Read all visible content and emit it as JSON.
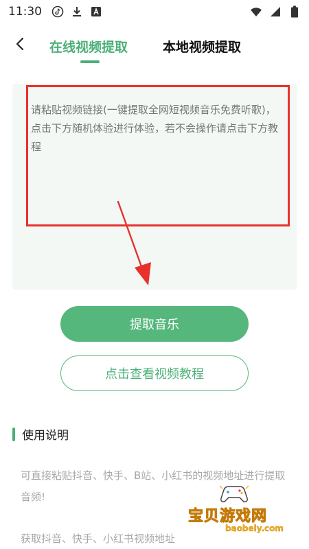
{
  "status_bar": {
    "time": "11:30",
    "left_icons": [
      "tiktok-icon",
      "download-icon",
      "a-badge-icon"
    ],
    "right_icons": [
      "wifi-icon",
      "signal-icon",
      "battery-icon"
    ]
  },
  "header": {
    "back_icon": "chevron-left-icon",
    "tabs": [
      {
        "label": "在线视频提取",
        "active": true
      },
      {
        "label": "本地视频提取",
        "active": false
      }
    ]
  },
  "input": {
    "placeholder": "请粘贴视频链接(一键提取全网短视频音乐免费听歌)，点击下方随机体验进行体验，若不会操作请点击下方教程",
    "value": ""
  },
  "buttons": {
    "extract_label": "提取音乐",
    "tutorial_label": "点击查看视频教程"
  },
  "instructions": {
    "title": "使用说明",
    "line1": "可直接粘贴抖音、快手、B站、小红书的视频地址进行提取音频!",
    "line2": "获取抖音、快手、小红书视频地址"
  },
  "watermark": {
    "cn": "宝贝游戏网",
    "en": "baobeiy.com"
  },
  "colors": {
    "accent": "#4caf78",
    "button_fill": "#55b77c",
    "highlight_box": "#e8312c",
    "panel_bg": "#f3f8f5"
  }
}
